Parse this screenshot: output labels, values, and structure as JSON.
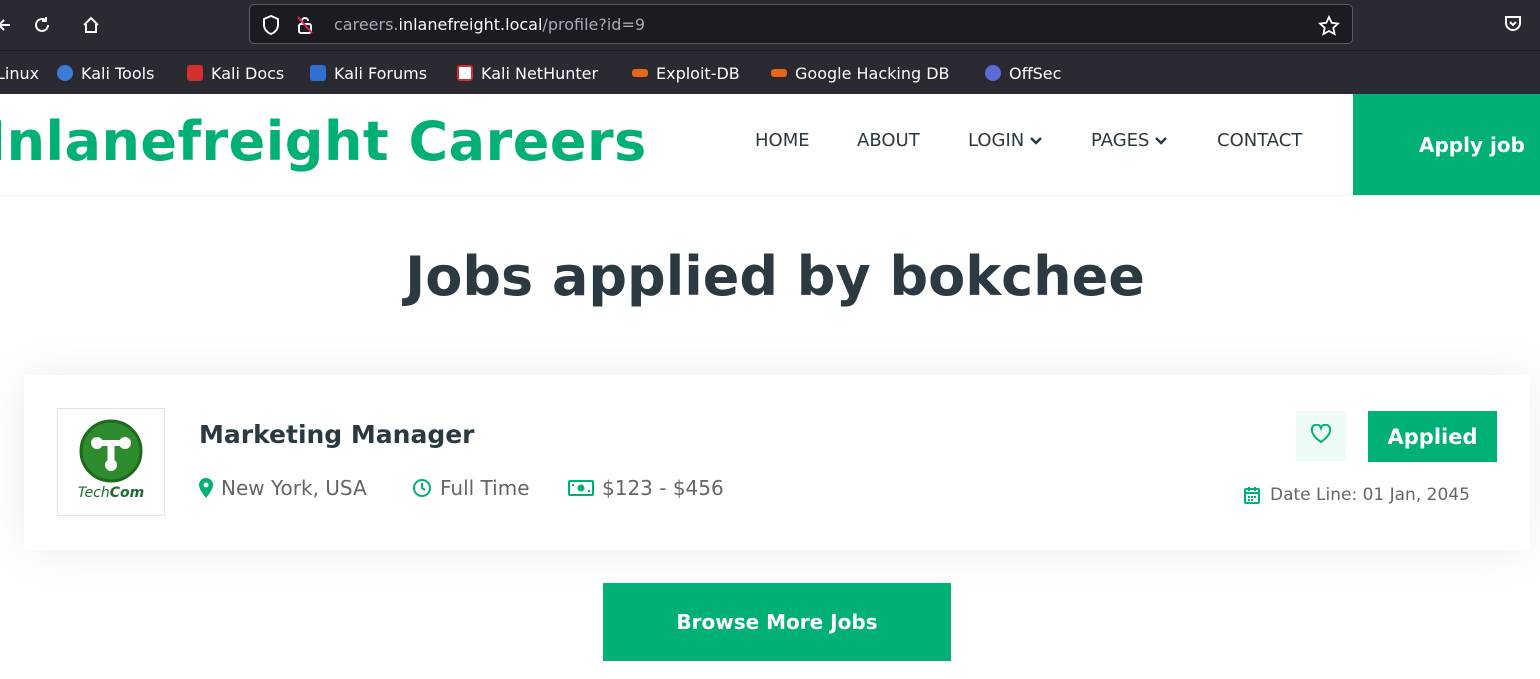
{
  "browser": {
    "url_host_prefix": "careers.",
    "url_host": "inlanefreight.local",
    "url_path": "/profile?id=9",
    "bookmarks": [
      {
        "label": "Linux",
        "color": "#2b2a33"
      },
      {
        "label": "Kali Tools",
        "color": "#3a7bd5"
      },
      {
        "label": "Kali Docs",
        "color": "#d32f2f"
      },
      {
        "label": "Kali Forums",
        "color": "#2f6fd6"
      },
      {
        "label": "Kali NetHunter",
        "color": "#d32f2f"
      },
      {
        "label": "Exploit-DB",
        "color": "#e8651a"
      },
      {
        "label": "Google Hacking DB",
        "color": "#e8651a"
      },
      {
        "label": "OffSec",
        "color": "#5b6bd8"
      }
    ]
  },
  "site": {
    "brand": "Inlanefreight Careers",
    "menu": {
      "home": "HOME",
      "about": "ABOUT",
      "login": "LOGIN",
      "pages": "PAGES",
      "contact": "CONTACT"
    },
    "apply_job": "Apply job",
    "accent": "#00b074"
  },
  "main": {
    "title": "Jobs applied by bokchee",
    "job": {
      "company_logo_text": "TechCom",
      "company_logo_prefix": "Tech",
      "company_logo_suffix": "Com",
      "title": "Marketing Manager",
      "location": "New York, USA",
      "type": "Full Time",
      "salary": "$123 - $456",
      "applied_label": "Applied",
      "date_line": "Date Line: 01 Jan, 2045"
    },
    "browse_more": "Browse More Jobs"
  }
}
